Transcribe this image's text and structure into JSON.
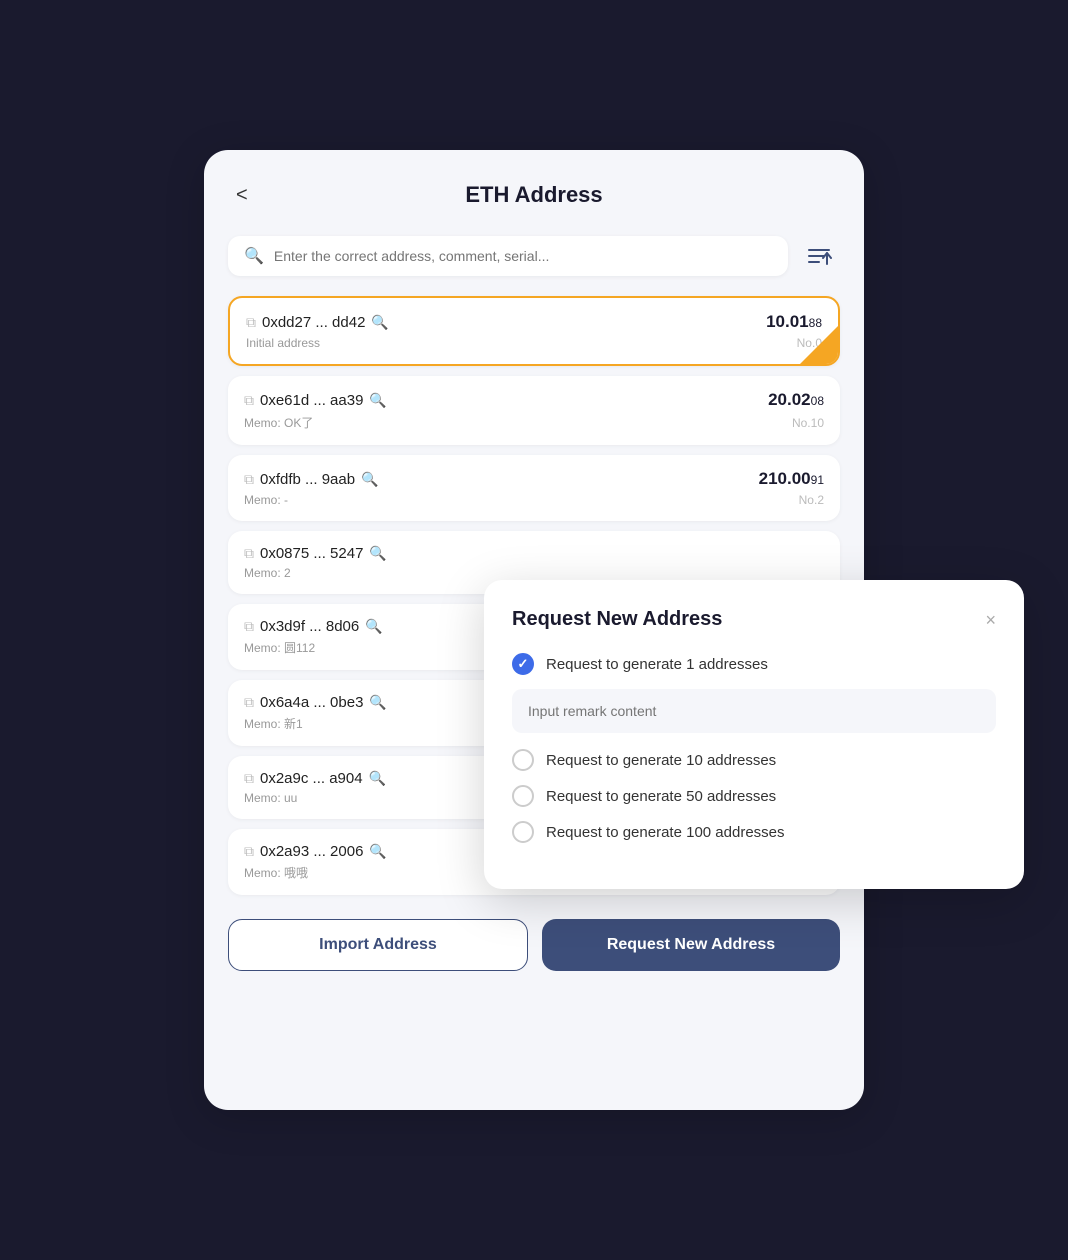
{
  "header": {
    "back_label": "<",
    "title": "ETH Address"
  },
  "search": {
    "placeholder": "Enter the correct address, comment, serial..."
  },
  "addresses": [
    {
      "addr": "0xdd27 ... dd42",
      "memo": "Initial address",
      "amount_main": "10.01",
      "amount_small": "88",
      "no": "No.0",
      "active": true
    },
    {
      "addr": "0xe61d ... aa39",
      "memo": "Memo: OK了",
      "amount_main": "20.02",
      "amount_small": "08",
      "no": "No.10",
      "active": false
    },
    {
      "addr": "0xfdfb ... 9aab",
      "memo": "Memo: -",
      "amount_main": "210.00",
      "amount_small": "91",
      "no": "No.2",
      "active": false
    },
    {
      "addr": "0x0875 ... 5247",
      "memo": "Memo: 2",
      "amount_main": "",
      "amount_small": "",
      "no": "",
      "active": false
    },
    {
      "addr": "0x3d9f ... 8d06",
      "memo": "Memo: 圆112",
      "amount_main": "",
      "amount_small": "",
      "no": "",
      "active": false
    },
    {
      "addr": "0x6a4a ... 0be3",
      "memo": "Memo: 新1",
      "amount_main": "",
      "amount_small": "",
      "no": "",
      "active": false
    },
    {
      "addr": "0x2a9c ... a904",
      "memo": "Memo: uu",
      "amount_main": "",
      "amount_small": "",
      "no": "",
      "active": false
    },
    {
      "addr": "0x2a93 ... 2006",
      "memo": "Memo: 哦哦",
      "amount_main": "",
      "amount_small": "",
      "no": "",
      "active": false
    }
  ],
  "footer": {
    "import_label": "Import Address",
    "request_label": "Request New Address"
  },
  "modal": {
    "title": "Request New Address",
    "close_label": "×",
    "remark_placeholder": "Input remark content",
    "options": [
      {
        "label": "Request to generate 1 addresses",
        "checked": true
      },
      {
        "label": "Request to generate 10 addresses",
        "checked": false
      },
      {
        "label": "Request to generate 50 addresses",
        "checked": false
      },
      {
        "label": "Request to generate 100 addresses",
        "checked": false
      }
    ]
  }
}
